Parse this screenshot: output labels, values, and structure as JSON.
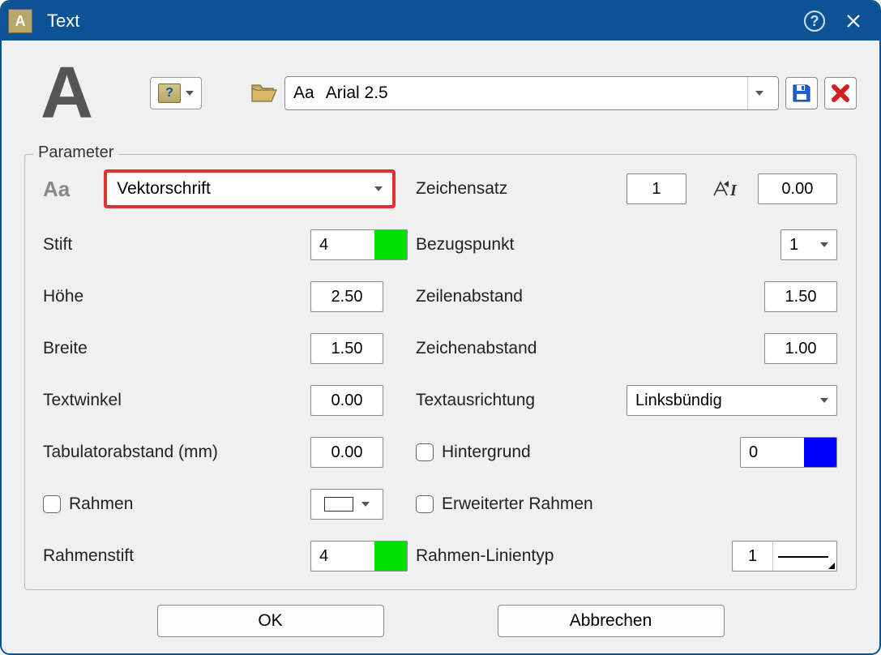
{
  "window": {
    "title": "Text"
  },
  "preset": {
    "prefix": "Aa",
    "label": "Arial 2.5"
  },
  "groupbox": {
    "title": "Parameter"
  },
  "fields": {
    "aa_prefix": "Aa",
    "font_type_label": "Vektorschrift",
    "charset_label": "Zeichensatz",
    "charset_value": "1",
    "italic_value": "0.00",
    "pen_label": "Stift",
    "pen_value": "4",
    "refpoint_label": "Bezugspunkt",
    "refpoint_value": "1",
    "height_label": "Höhe",
    "height_value": "2.50",
    "linespacing_label": "Zeilenabstand",
    "linespacing_value": "1.50",
    "width_label": "Breite",
    "width_value": "1.50",
    "charspacing_label": "Zeichenabstand",
    "charspacing_value": "1.00",
    "textangle_label": "Textwinkel",
    "textangle_value": "0.00",
    "textalign_label": "Textausrichtung",
    "textalign_value": "Linksbündig",
    "tab_label": "Tabulatorabstand (mm)",
    "tab_value": "0.00",
    "background_label": "Hintergrund",
    "background_value": "0",
    "frame_label": "Rahmen",
    "extframe_label": "Erweiterter Rahmen",
    "framepen_label": "Rahmenstift",
    "framepen_value": "4",
    "frameline_label": "Rahmen-Linientyp",
    "frameline_value": "1"
  },
  "buttons": {
    "ok": "OK",
    "cancel": "Abbrechen"
  }
}
